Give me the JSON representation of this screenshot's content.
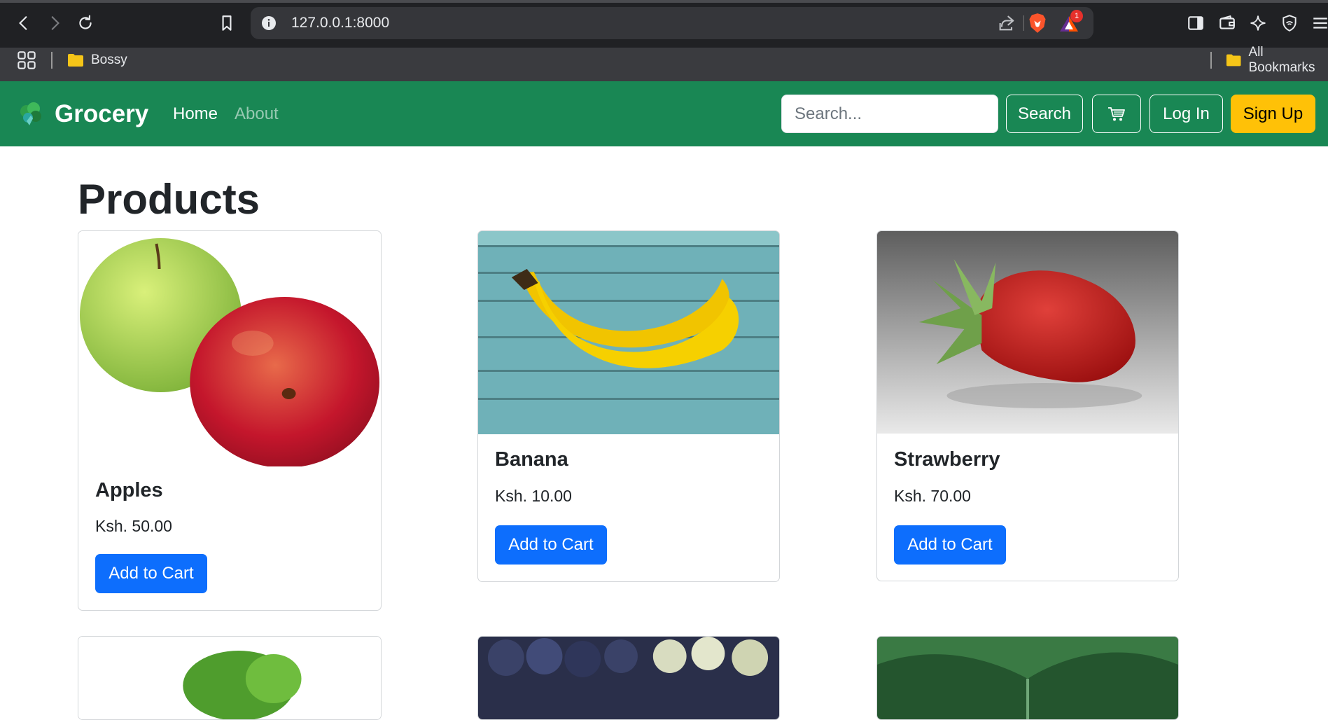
{
  "browser": {
    "url": "127.0.0.1:8000",
    "notification_count": "1",
    "bookmarks": [
      {
        "label": "Bossy"
      },
      {
        "label": "All Bookmarks"
      }
    ]
  },
  "navbar": {
    "brand": "Grocery",
    "links": [
      {
        "label": "Home",
        "active": true
      },
      {
        "label": "About",
        "active": false
      }
    ],
    "search_placeholder": "Search...",
    "search_button": "Search",
    "cart_icon": "cart-icon",
    "login": "Log In",
    "signup": "Sign Up",
    "colors": {
      "navbar": "#198754",
      "signup": "#ffc107",
      "primary": "#0d6efd"
    }
  },
  "page": {
    "title": "Products"
  },
  "products": [
    {
      "name": "Apples",
      "price": "Ksh. 50.00",
      "button": "Add to Cart",
      "image": "apples-image"
    },
    {
      "name": "Banana",
      "price": "Ksh. 10.00",
      "button": "Add to Cart",
      "image": "banana-image"
    },
    {
      "name": "Strawberry",
      "price": "Ksh. 70.00",
      "button": "Add to Cart",
      "image": "strawberry-image"
    },
    {
      "image": "lettuce-image"
    },
    {
      "image": "grapes-image"
    },
    {
      "image": "cabbage-image"
    }
  ]
}
